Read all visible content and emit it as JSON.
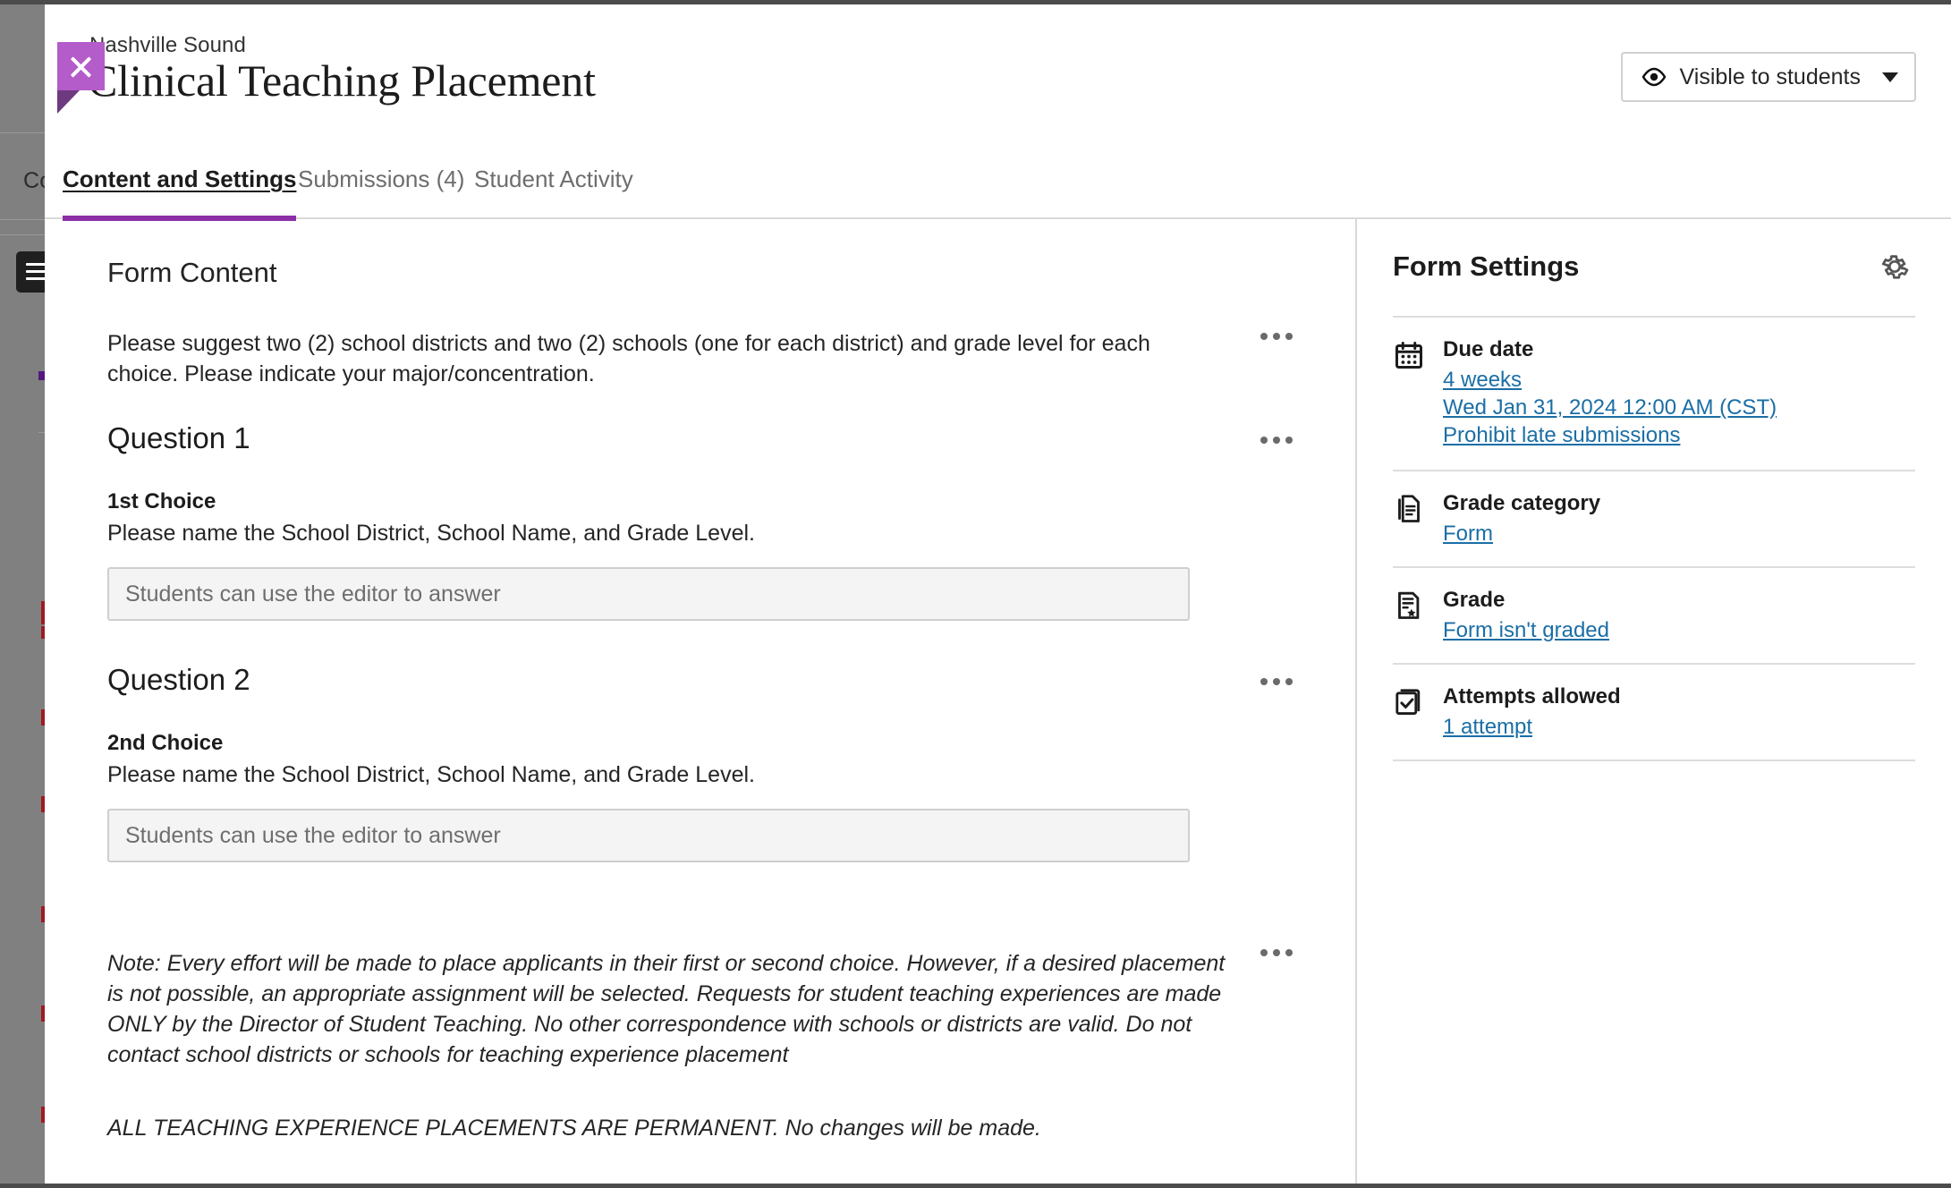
{
  "header": {
    "eyebrow": "Nashville Sound",
    "title": "Clinical Teaching Placement",
    "close_label": "Close",
    "visibility": {
      "label": "Visible to students",
      "icon": "eye-icon",
      "caret": "chevron-down-icon"
    }
  },
  "tabs": [
    {
      "label": "Content and Settings",
      "active": true
    },
    {
      "label": "Submissions (4)",
      "active": false
    },
    {
      "label": "Student Activity",
      "active": false
    }
  ],
  "content": {
    "section_title": "Form Content",
    "intro_text": "Please suggest two (2) school districts and two (2) schools (one for each district) and grade level for each choice. Please indicate your major/concentration.",
    "question1": {
      "heading": "Question 1",
      "choice_label": "1st Choice",
      "choice_sub": "Please name the School District, School Name, and Grade Level.",
      "answer_placeholder": "Students can use the editor to answer"
    },
    "question2": {
      "heading": "Question 2",
      "choice_label": "2nd Choice",
      "choice_sub": "Please name the School District, School Name, and Grade Level.",
      "answer_placeholder": "Students can use the editor to answer"
    },
    "note_paragraph": "Note: Every effort will be made to place applicants in their first or second choice. However, if a desired placement is not possible, an appropriate assignment will be selected. Requests for student teaching experiences are made ONLY by the Director of Student Teaching. No other correspondence with schools or districts are valid. Do not contact school districts or schools for teaching experience placement",
    "note_permanent": "ALL TEACHING EXPERIENCE PLACEMENTS ARE PERMANENT. No changes will be made.",
    "options_menu_label": "More options"
  },
  "settings": {
    "title": "Form Settings",
    "gear_label": "Form settings",
    "rows": [
      {
        "icon": "calendar-icon",
        "title": "Due date",
        "links": [
          "4 weeks",
          "Wed Jan 31, 2024 12:00 AM (CST)",
          "Prohibit late submissions"
        ]
      },
      {
        "icon": "document-stack-icon",
        "title": "Grade category",
        "links": [
          "Form"
        ]
      },
      {
        "icon": "document-star-icon",
        "title": "Grade",
        "links": [
          "Form isn't graded"
        ]
      },
      {
        "icon": "checkbox-stack-icon",
        "title": "Attempts allowed",
        "links": [
          "1 attempt"
        ]
      }
    ]
  },
  "background": {
    "nav_label": "Co",
    "menu_icon": "hamburger-icon"
  },
  "colors": {
    "accent_purple": "#8b2fa8",
    "close_purple": "#b45cc9",
    "close_fold_purple": "#6d3a80",
    "link_blue": "#1b6ea5",
    "backdrop_gray": "#808080"
  }
}
